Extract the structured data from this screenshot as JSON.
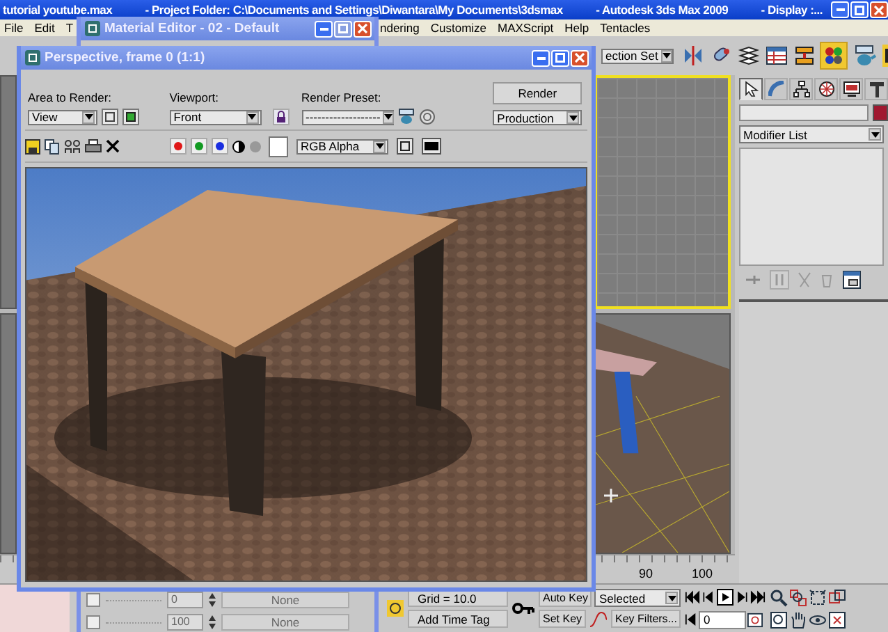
{
  "app_window": {
    "title_parts": [
      "tutorial youtube.max",
      "- Project Folder: C:\\Documents and Settings\\Diwantara\\My Documents\\3dsmax",
      "- Autodesk 3ds Max  2009",
      "- Display :..."
    ]
  },
  "menu": [
    "File",
    "Edit",
    "T",
    "ndering",
    "Customize",
    "MAXScript",
    "Help",
    "Tentacles"
  ],
  "toolbar": {
    "selection_set": "ection Set"
  },
  "command_panel": {
    "tabs": [
      {
        "selected": true
      },
      {
        "selected": false
      },
      {
        "selected": false
      },
      {
        "selected": false
      },
      {
        "selected": false
      },
      {
        "selected": false
      }
    ],
    "modifier_list": "Modifier List"
  },
  "timeline": {
    "ticks": [
      "90",
      "100"
    ]
  },
  "status": {
    "grid": "Grid = 10.0",
    "add_time_tag": "Add Time Tag"
  },
  "animation": {
    "auto_key": "Auto Key",
    "key_mode": "Selected",
    "set_key": "Set Key",
    "key_filters": "Key Filters...",
    "frame": "0"
  },
  "material_editor": {
    "title": "Material Editor - 02 - Default",
    "rows": [
      {
        "checked": false,
        "value": "0",
        "map": "None"
      },
      {
        "checked": false,
        "value": "100",
        "map": "None"
      }
    ]
  },
  "render_window": {
    "title": "Perspective, frame 0 (1:1)",
    "area_label": "Area to Render:",
    "area": "View",
    "viewport_label": "Viewport:",
    "viewport": "Front",
    "preset_label": "Render Preset:",
    "preset": "-------------------",
    "render": "Render",
    "mode": "Production",
    "display_channel": "RGB Alpha",
    "channels": [
      {
        "color": "#e01818"
      },
      {
        "color": "#129a22"
      },
      {
        "color": "#1a2ee0"
      }
    ]
  }
}
